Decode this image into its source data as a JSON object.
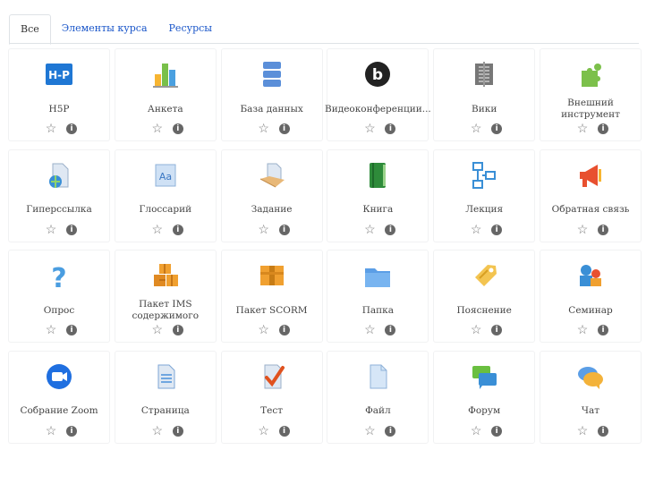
{
  "tabs": [
    {
      "label": "Все",
      "active": true
    },
    {
      "label": "Элементы курса",
      "active": false
    },
    {
      "label": "Ресурсы",
      "active": false
    }
  ],
  "icons": {
    "star": "☆",
    "info": "i"
  },
  "modules": [
    {
      "name": "H5P",
      "icon": "h5p-icon"
    },
    {
      "name": "Анкета",
      "icon": "bar-chart-icon"
    },
    {
      "name": "База данных",
      "icon": "database-icon"
    },
    {
      "name": "Видеоконференции...",
      "icon": "bigbluebutton-icon"
    },
    {
      "name": "Вики",
      "icon": "wiki-icon"
    },
    {
      "name": "Внешний инструмент",
      "icon": "puzzle-icon"
    },
    {
      "name": "Гиперссылка",
      "icon": "hyperlink-icon"
    },
    {
      "name": "Глоссарий",
      "icon": "glossary-icon"
    },
    {
      "name": "Задание",
      "icon": "assignment-icon"
    },
    {
      "name": "Книга",
      "icon": "book-icon"
    },
    {
      "name": "Лекция",
      "icon": "lesson-icon"
    },
    {
      "name": "Обратная связь",
      "icon": "megaphone-icon"
    },
    {
      "name": "Опрос",
      "icon": "question-icon"
    },
    {
      "name": "Пакет IMS содержимого",
      "icon": "ims-package-icon"
    },
    {
      "name": "Пакет SCORM",
      "icon": "scorm-package-icon"
    },
    {
      "name": "Папка",
      "icon": "folder-icon"
    },
    {
      "name": "Пояснение",
      "icon": "label-tag-icon"
    },
    {
      "name": "Семинар",
      "icon": "workshop-icon"
    },
    {
      "name": "Собрание Zoom",
      "icon": "zoom-icon"
    },
    {
      "name": "Страница",
      "icon": "page-icon"
    },
    {
      "name": "Тест",
      "icon": "quiz-icon"
    },
    {
      "name": "Файл",
      "icon": "file-icon"
    },
    {
      "name": "Форум",
      "icon": "forum-icon"
    },
    {
      "name": "Чат",
      "icon": "chat-icon"
    }
  ]
}
